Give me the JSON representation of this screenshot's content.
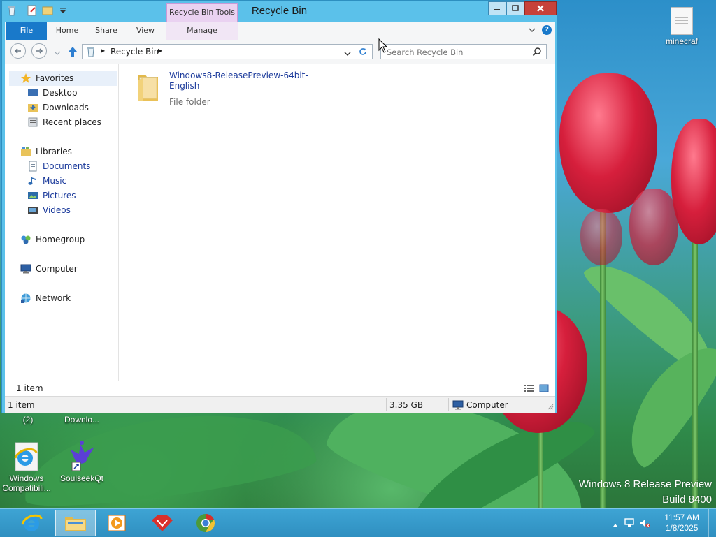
{
  "desktop": {
    "icons": [
      {
        "label": "minecraf"
      },
      {
        "label": "(2)"
      },
      {
        "label": "Downlo..."
      },
      {
        "label": "Windows\nCompatibili..."
      },
      {
        "label": "SoulseekQt"
      }
    ],
    "watermark_line1": "Windows 8 Release Preview",
    "watermark_line2": "Build 8400"
  },
  "window": {
    "title": "Recycle Bin",
    "context_tab": "Recycle Bin Tools",
    "ribbon_tabs": [
      "File",
      "Home",
      "Share",
      "View",
      "Manage"
    ],
    "address": {
      "location": "Recycle Bin"
    },
    "search": {
      "placeholder": "Search Recycle Bin"
    },
    "nav": {
      "favorites": "Favorites",
      "desktop": "Desktop",
      "downloads": "Downloads",
      "recent": "Recent places",
      "libraries": "Libraries",
      "documents": "Documents",
      "music": "Music",
      "pictures": "Pictures",
      "videos": "Videos",
      "homegroup": "Homegroup",
      "computer": "Computer",
      "network": "Network"
    },
    "items": [
      {
        "name": "Windows8-ReleasePreview-64bit-English",
        "type": "File folder"
      }
    ],
    "inner_status": "1 item",
    "status": {
      "items": "1 item",
      "size": "3.35 GB",
      "location": "Computer"
    }
  },
  "taskbar": {
    "apps": [
      "internet-explorer",
      "file-explorer",
      "media-player",
      "red-app",
      "chrome"
    ],
    "clock_time": "11:57 AM",
    "clock_date": "1/8/2025"
  },
  "colors": {
    "window_frame": "#5bc1ea",
    "file_tab": "#1979ca",
    "context_tab": "#ead2f1",
    "close_button": "#c7423a",
    "taskbar": "#3ea4d4",
    "link_text": "#1b3a9b"
  }
}
